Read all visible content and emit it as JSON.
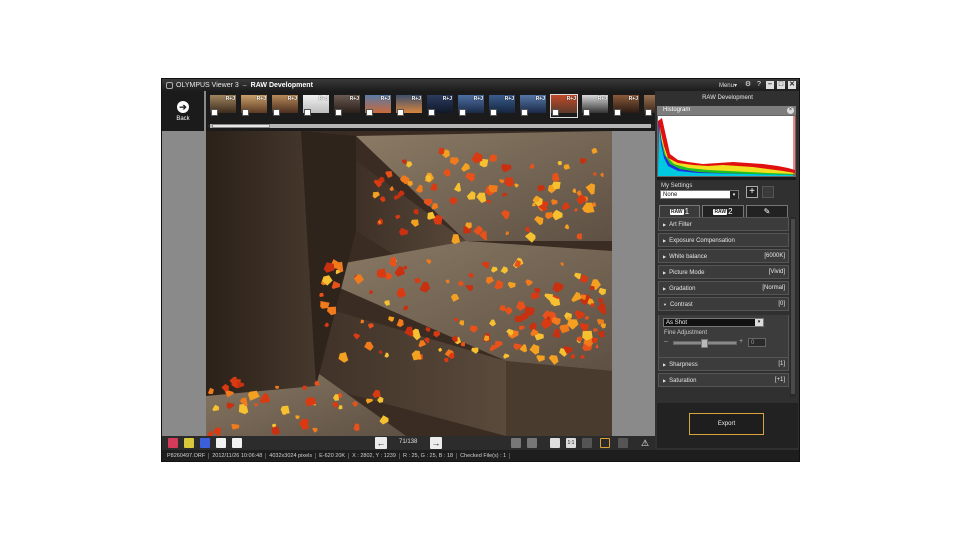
{
  "window": {
    "app_name": "OLYMPUS Viewer 3",
    "separator": "–",
    "mode": "RAW Development",
    "menu_label": "Menu▾",
    "gear": "⚙",
    "help": "?",
    "minimize": "–",
    "restore": "□",
    "close": "✕"
  },
  "back": {
    "icon": "➔",
    "label": "Back"
  },
  "filmstrip": {
    "thumbs": [
      {
        "badge": "R+J",
        "colors": [
          "#a0855f",
          "#3c2a1c"
        ],
        "selected": false
      },
      {
        "badge": "R+J",
        "colors": [
          "#c9a06a",
          "#5c3a22"
        ],
        "selected": false
      },
      {
        "badge": "R+J",
        "colors": [
          "#b88a5a",
          "#4a2e1e"
        ],
        "selected": false
      },
      {
        "badge": "R+J",
        "colors": [
          "#f0f0f0",
          "#bdbdbd"
        ],
        "selected": false
      },
      {
        "badge": "R+J",
        "colors": [
          "#6a5a52",
          "#2a1e18"
        ],
        "selected": false
      },
      {
        "badge": "R+J",
        "colors": [
          "#5b7ca8",
          "#c96a3a"
        ],
        "selected": false
      },
      {
        "badge": "R+J",
        "colors": [
          "#3b4f6e",
          "#d8863e"
        ],
        "selected": false
      },
      {
        "badge": "R+J",
        "colors": [
          "#2c3b5e",
          "#10182a"
        ],
        "selected": false
      },
      {
        "badge": "R+J",
        "colors": [
          "#4d6fa3",
          "#1b2a48"
        ],
        "selected": false
      },
      {
        "badge": "R+J",
        "colors": [
          "#3a5b8c",
          "#152540"
        ],
        "selected": false
      },
      {
        "badge": "R+J",
        "colors": [
          "#5577a6",
          "#1a2948"
        ],
        "selected": false
      },
      {
        "badge": "R+J",
        "colors": [
          "#c14a2a",
          "#5a3a2a"
        ],
        "selected": true
      },
      {
        "badge": "R+J",
        "colors": [
          "#d9d9d9",
          "#333333"
        ],
        "selected": false
      },
      {
        "badge": "R+J",
        "colors": [
          "#8a5a3a",
          "#2a1a12"
        ],
        "selected": false
      },
      {
        "badge": "R+J",
        "colors": [
          "#9a7050",
          "#3a2618"
        ],
        "selected": false
      }
    ]
  },
  "toolbar": {
    "prev_icon": "←",
    "next_icon": "→",
    "pager": "71/138",
    "one_to_one": "1:1"
  },
  "status": {
    "file": "P8260497.ORF",
    "datetime": "2012/11/26 10:06:48",
    "pixels": "4032x3024 pixels",
    "exposure": "E-620 20K",
    "coords": "X : 2802, Y : 1239",
    "rgb": "R : 25, G : 25, B : 18",
    "checked": "Checked File(s) : 1"
  },
  "panel": {
    "title": "RAW Development",
    "histogram_label": "Histogram",
    "my_settings_label": "My Settings",
    "my_settings_value": "None",
    "tabs": [
      {
        "raw": "RAW",
        "num": "1"
      },
      {
        "raw": "RAW",
        "num": "2"
      },
      {
        "raw": "",
        "num": "✎"
      }
    ],
    "rows": [
      {
        "label": "Art Filter",
        "value": "",
        "open": false
      },
      {
        "label": "Exposure Compensation",
        "value": "",
        "open": false
      },
      {
        "label": "White balance",
        "value": "[6000K]",
        "open": false
      },
      {
        "label": "Picture Mode",
        "value": "[Vivid]",
        "open": false
      },
      {
        "label": "Gradation",
        "value": "[Normal]",
        "open": false
      },
      {
        "label": "Contrast",
        "value": "[0]",
        "open": true
      },
      {
        "label": "Sharpness",
        "value": "[1]",
        "open": false
      },
      {
        "label": "Saturation",
        "value": "[+1]",
        "open": false
      }
    ],
    "contrast": {
      "select_value": "As Shot",
      "fine_label": "Fine Adjustment",
      "value": "0",
      "minus": "–",
      "plus": "+"
    },
    "export_label": "Export"
  }
}
